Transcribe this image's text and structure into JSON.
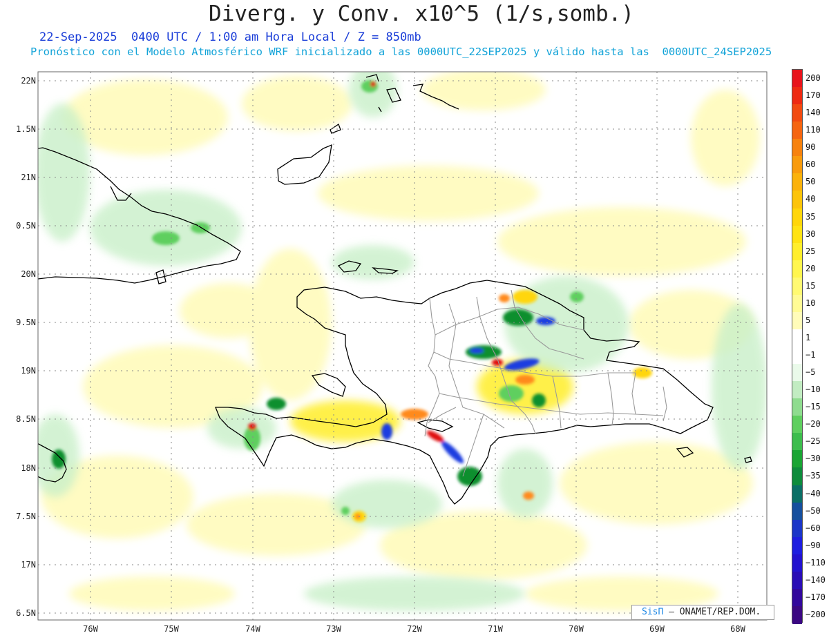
{
  "header": {
    "title": "Diverg. y Conv. x10^5 (1/s,somb.)",
    "subtitle": "22-Sep-2025  0400 UTC / 1:00 am Hora Local / Z = 850mb",
    "info": "Pronóstico con el Modelo Atmosférico WRF inicializado a las 0000UTC_22SEP2025 y válido hasta las  0000UTC_24SEP2025"
  },
  "map": {
    "lat_ticks": [
      "22N",
      "1.5N",
      "21N",
      "0.5N",
      "20N",
      "9.5N",
      "19N",
      "8.5N",
      "18N",
      "7.5N",
      "17N",
      "6.5N"
    ],
    "lon_ticks": [
      "76W",
      "75W",
      "74W",
      "73W",
      "72W",
      "71W",
      "70W",
      "69W",
      "68W"
    ],
    "lat_range": [
      16.5,
      22.0
    ],
    "lon_range": [
      -76.6,
      -67.6
    ],
    "land_color": "#ffffff",
    "field_colors": {
      "convergence_weak": "#c9f0c9",
      "convergence_moderate": "#5fcf5f",
      "convergence_strong": "#0f8f2f",
      "convergence_extreme": "#1e3ce0",
      "divergence_weak": "#fffbb8",
      "divergence_moderate": "#ffe033",
      "divergence_strong": "#ff8a1a",
      "divergence_extreme": "#e01010"
    }
  },
  "colorbar": {
    "labels": [
      "200",
      "170",
      "140",
      "110",
      "90",
      "60",
      "50",
      "40",
      "35",
      "30",
      "25",
      "20",
      "15",
      "10",
      "5",
      "1",
      "−1",
      "−5",
      "−10",
      "−15",
      "−20",
      "−25",
      "−30",
      "−35",
      "−40",
      "−50",
      "−60",
      "−90",
      "−110",
      "−140",
      "−170",
      "−200"
    ],
    "colors": [
      "#e8141c",
      "#ee2a12",
      "#f24a10",
      "#f56510",
      "#f7820e",
      "#f99b0d",
      "#fbb20c",
      "#fdc40a",
      "#ffd60a",
      "#ffe313",
      "#ffee2c",
      "#fff64e",
      "#fffa72",
      "#fffb95",
      "#fffcb9",
      "#ffffff",
      "#ffffff",
      "#eafaea",
      "#c2ecc2",
      "#8fdc8f",
      "#5fcf5f",
      "#3dbd4d",
      "#1aa534",
      "#0e8c3c",
      "#0b6f66",
      "#164f9e",
      "#1b36c8",
      "#1e1ee0",
      "#2312cf",
      "#2a0db6",
      "#32089c",
      "#3b0882"
    ]
  },
  "credit": {
    "brand": "SisΠ",
    "org": "– ONAMET/REP.DOM."
  }
}
